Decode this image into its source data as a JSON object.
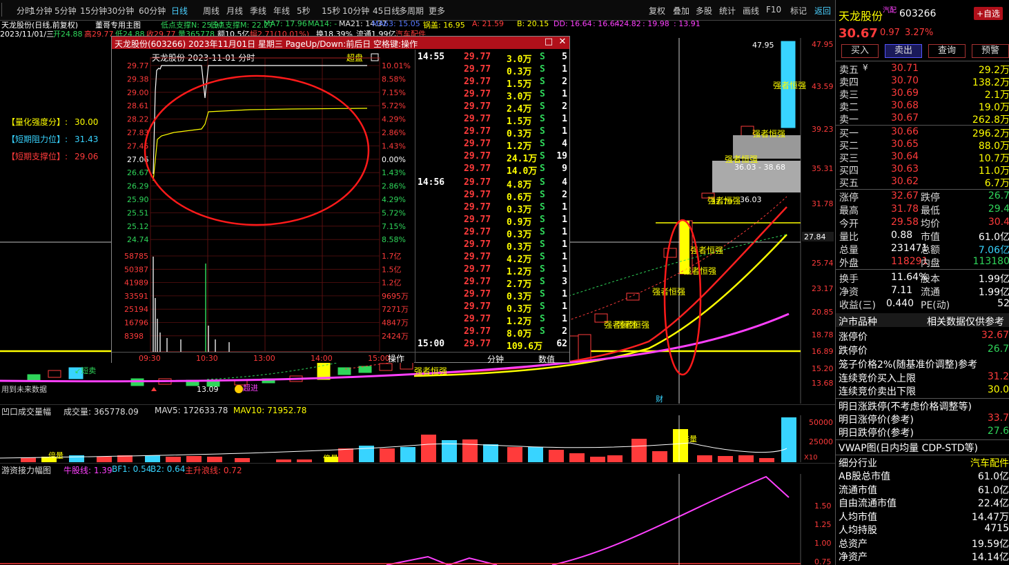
{
  "toolbar": {
    "items": [
      "分时",
      "1分钟",
      "5分钟",
      "15分钟",
      "30分钟",
      "60分钟",
      "日线",
      "周线",
      "月线",
      "季线",
      "年线",
      "5秒",
      "15秒",
      "10分钟",
      "45日线",
      "多周期",
      "更多"
    ],
    "active": "日线",
    "right": [
      "复权",
      "叠加",
      "多股",
      "统计",
      "画线",
      "F10",
      "标记",
      "返回"
    ]
  },
  "ind_line": {
    "title": "天龙股份(日线,前复权)",
    "formula": "董哥专用主图",
    "items": [
      {
        "t": "低点支撑N: 25.97",
        "c": "#2fd65a"
      },
      {
        "t": "低点支撑M: 22.27",
        "c": "#2fd65a"
      },
      {
        "t": "MA7: 17.96",
        "c": "#2fd65a"
      },
      {
        "t": "MA14: -",
        "c": "#2fd65a"
      },
      {
        "t": "MA21: 14.37",
        "c": "#e6e6e6"
      },
      {
        "t": "MA63: 15.05",
        "c": "#5577ff"
      },
      {
        "t": "锅盖: 16.95",
        "c": "#ffff00"
      },
      {
        "t": "A: 21.59",
        "c": "#ff3b3b"
      },
      {
        "t": "B: 20.15",
        "c": "#ffff00"
      },
      {
        "t": "DD: 16.64",
        "c": "#ff40ff"
      },
      {
        "t": ": 16.64",
        "c": "#ff40ff"
      },
      {
        "t": ": 24.82",
        "c": "#ff40ff"
      },
      {
        "t": ": 19.98",
        "c": "#ff40ff"
      },
      {
        "t": ": 13.91",
        "c": "#ff40ff"
      }
    ]
  },
  "date_line": {
    "date": "2023/11/01/三",
    "open": "开24.88",
    "high": "高29.77",
    "low": "低24.88",
    "close": "收29.77",
    "vol": "量365778",
    "amt": "额10.5亿",
    "amp": "幅2.71(10.01%)",
    "turn": "换18.39%",
    "float": "流通1.99亿",
    "extra": "汽车配件"
  },
  "left_labels": [
    {
      "label": "【量化强度分】:",
      "value": "30.00",
      "c": "#ffff00"
    },
    {
      "label": "【短期阻力位】:",
      "value": "31.43",
      "c": "#38d4ff"
    },
    {
      "label": "【短期支撑位】:",
      "value": "29.06",
      "c": "#ff3b3b"
    }
  ],
  "price_axis": [
    "47.95",
    "43.59",
    "39.23",
    "35.31",
    "31.78",
    "27.84",
    "25.74",
    "23.17",
    "20.85",
    "18.78",
    "16.89",
    "15.20",
    "13.68"
  ],
  "annotations": {
    "strong": "强者恒强",
    "chao": "超买",
    "ni": "↙短卖",
    "chaojin": "超进",
    "low_price": "13.09",
    "high_price": "47.95",
    "gap1": "36.03 - 38.68",
    "gap2_a": "32.79",
    "gap2_b": "36.03",
    "future": "用到未来数据",
    "cai": "财",
    "beiliang": "倍量",
    "beiliang2": "倍量",
    "x10": "X10"
  },
  "vol": {
    "title": "凹口成交量幅",
    "vol": "成交量: 365778.09",
    "mav5": "MAV5: 172633.78",
    "mav10": "MAV10: 71952.78",
    "axis": [
      "50000",
      "25000"
    ]
  },
  "ind2": {
    "title": "游资接力幅图",
    "niugu": "牛股线: 1.39",
    "bf1": "BF1: 0.54",
    "b2": "B2: 0.64",
    "zhusheng": "主升浪线: 0.72",
    "axis": [
      "1.50",
      "1.25",
      "1.00",
      "0.75"
    ]
  },
  "popup": {
    "title": "天龙股份(603266) 2023年11月01日 星期三 PageUp/Down:前后日 空格键:操作",
    "mini_title": "天龙股份 2023-11-01 分时",
    "chaopan": "超盘",
    "prices": [
      "29.77",
      "29.38",
      "29.00",
      "28.61",
      "28.22",
      "27.83",
      "27.45",
      "27.06",
      "26.67",
      "26.29",
      "25.90",
      "25.51",
      "25.12",
      "24.74"
    ],
    "pcts": [
      "10.01%",
      "8.58%",
      "7.15%",
      "5.72%",
      "4.29%",
      "2.86%",
      "1.43%",
      "0.00%",
      "1.43%",
      "2.86%",
      "4.29%",
      "5.72%",
      "7.15%",
      "8.58%"
    ],
    "vols": [
      "58785",
      "50387",
      "41989",
      "33591",
      "25194",
      "16796",
      "8398"
    ],
    "amts": [
      "1.7亿",
      "1.5亿",
      "1.2亿",
      "9695万",
      "7271万",
      "4847万",
      "2424万"
    ],
    "times": [
      "09:30",
      "10:30",
      "13:00",
      "14:00",
      "15:00"
    ],
    "tabs": [
      "操作",
      "分笔",
      "分钟",
      "数值"
    ],
    "ticks": [
      {
        "time": "14:55",
        "price": "29.77",
        "vol": "3.0万",
        "bs": "S",
        "n": "5"
      },
      {
        "time": "",
        "price": "29.77",
        "vol": "0.3万",
        "bs": "S",
        "n": "1"
      },
      {
        "time": "",
        "price": "29.77",
        "vol": "1.5万",
        "bs": "S",
        "n": "2"
      },
      {
        "time": "",
        "price": "29.77",
        "vol": "3.0万",
        "bs": "S",
        "n": "1"
      },
      {
        "time": "",
        "price": "29.77",
        "vol": "2.4万",
        "bs": "S",
        "n": "2"
      },
      {
        "time": "",
        "price": "29.77",
        "vol": "1.5万",
        "bs": "S",
        "n": "1"
      },
      {
        "time": "",
        "price": "29.77",
        "vol": "0.3万",
        "bs": "S",
        "n": "1"
      },
      {
        "time": "",
        "price": "29.77",
        "vol": "1.2万",
        "bs": "S",
        "n": "4"
      },
      {
        "time": "",
        "price": "29.77",
        "vol": "24.1万",
        "bs": "S",
        "n": "19"
      },
      {
        "time": "",
        "price": "29.77",
        "vol": "14.0万",
        "bs": "S",
        "n": "9"
      },
      {
        "time": "14:56",
        "price": "29.77",
        "vol": "4.8万",
        "bs": "S",
        "n": "4"
      },
      {
        "time": "",
        "price": "29.77",
        "vol": "0.6万",
        "bs": "S",
        "n": "2"
      },
      {
        "time": "",
        "price": "29.77",
        "vol": "0.3万",
        "bs": "S",
        "n": "1"
      },
      {
        "time": "",
        "price": "29.77",
        "vol": "0.9万",
        "bs": "S",
        "n": "1"
      },
      {
        "time": "",
        "price": "29.77",
        "vol": "0.3万",
        "bs": "S",
        "n": "1"
      },
      {
        "time": "",
        "price": "29.77",
        "vol": "0.3万",
        "bs": "S",
        "n": "1"
      },
      {
        "time": "",
        "price": "29.77",
        "vol": "4.2万",
        "bs": "S",
        "n": "1"
      },
      {
        "time": "",
        "price": "29.77",
        "vol": "1.2万",
        "bs": "S",
        "n": "1"
      },
      {
        "time": "",
        "price": "29.77",
        "vol": "2.7万",
        "bs": "S",
        "n": "3"
      },
      {
        "time": "",
        "price": "29.77",
        "vol": "0.3万",
        "bs": "S",
        "n": "1"
      },
      {
        "time": "",
        "price": "29.77",
        "vol": "0.3万",
        "bs": "S",
        "n": "1"
      },
      {
        "time": "",
        "price": "29.77",
        "vol": "1.2万",
        "bs": "S",
        "n": "1"
      },
      {
        "time": "",
        "price": "29.77",
        "vol": "8.0万",
        "bs": "S",
        "n": "2"
      },
      {
        "time": "15:00",
        "price": "29.77",
        "vol": "109.6万",
        "bs": "",
        "n": "62"
      }
    ]
  },
  "right": {
    "name": "天龙股份",
    "tag": "汽配",
    "code": "603266",
    "fav": "+自选",
    "price": "30.67",
    "chg": "0.97",
    "pct": "3.27%",
    "buttons": [
      "买入",
      "卖出",
      "查询",
      "预警"
    ],
    "book": [
      {
        "l": "卖五",
        "y": "¥",
        "p": "30.71",
        "v": "29.2万"
      },
      {
        "l": "卖四",
        "p": "30.70",
        "v": "138.2万"
      },
      {
        "l": "卖三",
        "p": "30.69",
        "v": "2.1万"
      },
      {
        "l": "卖二",
        "p": "30.68",
        "v": "19.0万"
      },
      {
        "l": "卖一",
        "p": "30.67",
        "v": "262.8万"
      },
      {
        "l": "买一",
        "p": "30.66",
        "v": "296.2万"
      },
      {
        "l": "买二",
        "p": "30.65",
        "v": "88.0万"
      },
      {
        "l": "买三",
        "p": "30.64",
        "v": "10.7万"
      },
      {
        "l": "买四",
        "p": "30.63",
        "v": "11.0万"
      },
      {
        "l": "买五",
        "p": "30.62",
        "v": "6.7万"
      }
    ],
    "stats": [
      {
        "a": "涨停",
        "av": "32.67",
        "b": "跌停",
        "bv": "26.7"
      },
      {
        "a": "最高",
        "av": "31.78",
        "b": "最低",
        "bv": "29.4"
      },
      {
        "a": "今开",
        "av": "29.58",
        "b": "均价",
        "bv": "30.4"
      },
      {
        "a": "量比",
        "av": "0.88",
        "b": "市值",
        "bv": "61.0亿"
      },
      {
        "a": "总量",
        "av": "231471",
        "b": "总额",
        "bv": "7.06亿"
      },
      {
        "a": "外盘",
        "av": "118291",
        "b": "内盘",
        "bv": "113180"
      },
      {
        "a": "换手",
        "av": "11.64%",
        "b": "股本",
        "bv": "1.99亿"
      },
      {
        "a": "净资",
        "av": "7.11",
        "b": "流通",
        "bv": "1.99亿"
      },
      {
        "a": "收益(三)",
        "av": "0.440",
        "b": "PE(动)",
        "bv": "52"
      }
    ],
    "market": "沪市品种",
    "market_note": "相关数据仅供参考",
    "limits": [
      {
        "l": "涨停价",
        "v": "32.67"
      },
      {
        "l": "跌停价",
        "v": "26.7"
      }
    ],
    "cage": "笼子价格2%(随基准价调整)参考",
    "cage_rows": [
      {
        "l": "连续竞价买入上限",
        "v": "31.2"
      },
      {
        "l": "连续竞价卖出下限",
        "v": "30.0"
      }
    ],
    "tmr": "明日涨跌停(不考虑价格调整等)",
    "tmr_rows": [
      {
        "l": "明日涨停价(参考)",
        "v": "33.7"
      },
      {
        "l": "明日跌停价(参考)",
        "v": "27.6"
      }
    ],
    "vwap": "VWAP图(日内均量 CDP-STD等)",
    "industry_l": "细分行业",
    "industry_v": "汽车配件",
    "fund": [
      {
        "l": "AB股总市值",
        "v": "61.0亿"
      },
      {
        "l": "流通市值",
        "v": "61.0亿"
      },
      {
        "l": "自由流通市值",
        "v": "22.4亿"
      },
      {
        "l": "人均市值",
        "v": "14.47万"
      },
      {
        "l": "人均持股",
        "v": "4715"
      },
      {
        "l": "总资产",
        "v": "19.59亿"
      },
      {
        "l": "净资产",
        "v": "14.14亿"
      }
    ]
  },
  "colors": {
    "up": "#ff3b3b",
    "down": "#2fd65a",
    "bg": "#000000",
    "ma": "#ffff00",
    "mag": "#ff40ff",
    "cyan": "#38d4ff"
  }
}
